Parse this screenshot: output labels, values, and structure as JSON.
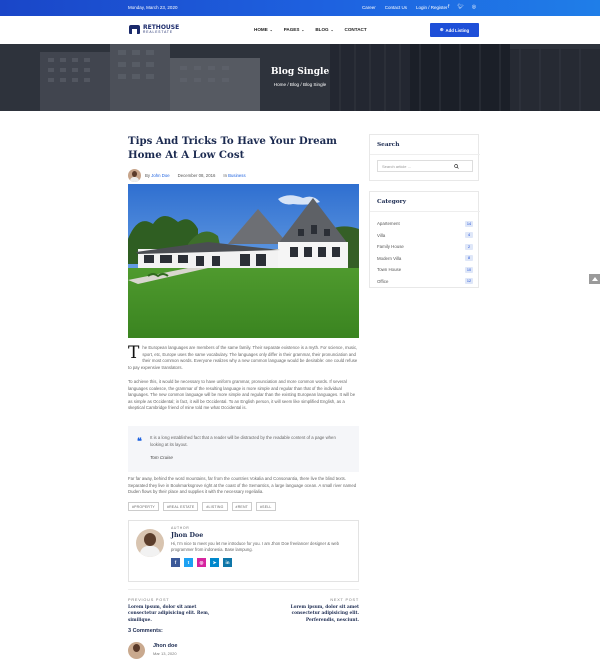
{
  "topbar": {
    "date": "Monday, March 23, 2020",
    "links": [
      "Career",
      "Contact Us",
      "Login / Register"
    ],
    "social_icons": [
      "facebook-icon",
      "twitter-icon",
      "instagram-icon"
    ]
  },
  "header": {
    "logo_name": "RETHOUSE",
    "logo_sub": "REALESTATE",
    "nav": [
      "HOME",
      "PAGES",
      "BLOG",
      "CONTACT"
    ],
    "add_listing": "Add Listing"
  },
  "hero": {
    "title": "Blog Single",
    "breadcrumb": [
      "Home",
      "Blog",
      "Blog Single"
    ]
  },
  "post": {
    "title": "Tips And Tricks To Have Your Dream Home At A Low Cost",
    "by": "By",
    "author": "John Doe",
    "date": "December 08, 2016",
    "in": "In",
    "category": "Business",
    "dropcap": "T",
    "para1": "he European languages are members of the same family. Their separate existence is a myth. For science, music, sport, etc, Europe uses the same vocabulary. The languages only differ in their grammar, their pronunciation and their most common words. Everyone realizes why a new common language would be desirable: one could refuse to pay expensive translators.",
    "para2": "To achieve this, it would be necessary to have uniform grammar, pronunciation and more common words. If several languages coalesce, the grammar of the resulting language is more simple and regular than that of the individual languages. The new common language will be more simple and regular than the existing European languages. It will be as simple as Occidental; in fact, it will be Occidental. To an English person, it will seem like simplified English, as a skeptical Cambridge friend of mine told me what Occidental is.",
    "quote": "It is a long established fact that a reader will be distracted by the readable content of a page when looking at its layout.",
    "quote_author": "Tom Cruise",
    "para3": "Far far away, behind the word mountains, far from the countries Vokalia and Consonantia, there live the blind texts. Separated they live in Bookmarksgrove right at the coast of the Semantics, a large language ocean. A small river named Duden flows by their place and supplies it with the necessary regelialia.",
    "tags": [
      "#PROPERTY",
      "#REAL ESTATE",
      "#LISTING",
      "#RENT",
      "#SELL"
    ]
  },
  "author_box": {
    "label": "AUTHOR",
    "name": "Jhon Doe",
    "bio": "Hi, I'm nice to meet you let me introduce for you. I am Jhon Doe freelancer designer & web programmer from indonesia. Base lampung.",
    "social": [
      {
        "icon": "facebook-icon",
        "glyph": "f",
        "color": "#3b5998"
      },
      {
        "icon": "twitter-icon",
        "glyph": "t",
        "color": "#1da1f2"
      },
      {
        "icon": "instagram-icon",
        "glyph": "◎",
        "color": "#d6249f"
      },
      {
        "icon": "telegram-icon",
        "glyph": "➤",
        "color": "#0088cc"
      },
      {
        "icon": "linkedin-icon",
        "glyph": "in",
        "color": "#0e76a8"
      }
    ]
  },
  "post_nav": {
    "prev_label": "PREVIOUS POST",
    "prev_title": "Lorem ipsum, dolor sit amet consectetur adipisicing elit. Rem, similique.",
    "next_label": "NEXT POST",
    "next_title": "Lorem ipsum, dolor sit amet consectetur adipisicing elit. Perferendis, nesciunt."
  },
  "comments": {
    "heading": "3 Comments:",
    "first_name": "Jhon doe",
    "first_date": "Mar 13, 2020"
  },
  "sidebar": {
    "search_title": "Search",
    "search_placeholder": "Search article ...",
    "category_title": "Category",
    "categories": [
      {
        "label": "Apartement",
        "count": "14"
      },
      {
        "label": "Villa",
        "count": "4"
      },
      {
        "label": "Family House",
        "count": "2"
      },
      {
        "label": "Modern Villa",
        "count": "8"
      },
      {
        "label": "Town House",
        "count": "10"
      },
      {
        "label": "Office",
        "count": "12"
      }
    ]
  },
  "colors": {
    "brand_blue": "#1e4fd8",
    "navy": "#1b2a50"
  }
}
